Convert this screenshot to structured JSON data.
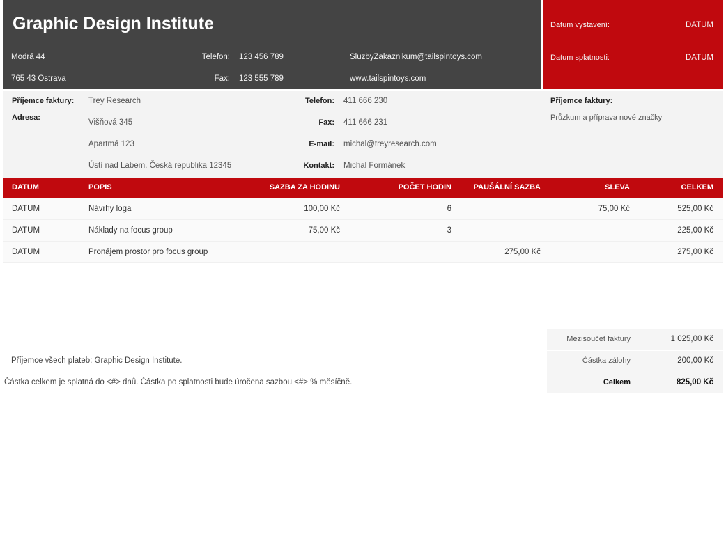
{
  "company": {
    "name": "Graphic Design Institute",
    "street": "Modrá 44",
    "city": "765 43 Ostrava",
    "phone_label": "Telefon:",
    "phone": "123 456 789",
    "fax_label": "Fax:",
    "fax": "123 555 789",
    "email": "SluzbyZakaznikum@tailspintoys.com",
    "web": "www.tailspintoys.com"
  },
  "dates": {
    "issue_label": "Datum vystavení:",
    "issue_value": "DATUM",
    "due_label": "Datum splatnosti:",
    "due_value": "DATUM"
  },
  "bill_to": {
    "recipient_label": "Příjemce faktury:",
    "recipient": "Trey Research",
    "address_label": "Adresa:",
    "address_lines": [
      "Višňová 345",
      "Apartmá 123",
      "Ústí nad Labem, Česká republika 12345"
    ],
    "phone_label": "Telefon:",
    "phone": "411 666 230",
    "fax_label": "Fax:",
    "fax": "411 666 231",
    "email_label": "E-mail:",
    "email": "michal@treyresearch.com",
    "contact_label": "Kontakt:",
    "contact": "Michal Formánek",
    "project_label": "Příjemce faktury:",
    "project": "Průzkum a příprava nové značky"
  },
  "table": {
    "headers": {
      "date": "DATUM",
      "desc": "POPIS",
      "rate": "SAZBA ZA HODINU",
      "hours": "POČET HODIN",
      "flat": "PAUŠÁLNÍ SAZBA",
      "discount": "SLEVA",
      "total": "CELKEM"
    },
    "rows": [
      {
        "date": "DATUM",
        "desc": "Návrhy loga",
        "rate": "100,00 Kč",
        "hours": "6",
        "flat": "",
        "discount": "75,00 Kč",
        "total": "525,00 Kč"
      },
      {
        "date": "DATUM",
        "desc": "Náklady na focus group",
        "rate": "75,00 Kč",
        "hours": "3",
        "flat": "",
        "discount": "",
        "total": "225,00 Kč"
      },
      {
        "date": "DATUM",
        "desc": "Pronájem prostor pro focus group",
        "rate": "",
        "hours": "",
        "flat": "275,00 Kč",
        "discount": "",
        "total": "275,00 Kč"
      }
    ]
  },
  "totals": {
    "subtotal_label": "Mezisoučet faktury",
    "subtotal": "1 025,00 Kč",
    "deposit_label": "Částka zálohy",
    "deposit": "200,00 Kč",
    "total_label": "Celkem",
    "total": "825,00 Kč"
  },
  "notes": {
    "payee": "Příjemce všech plateb: Graphic Design Institute.",
    "terms": "Částka celkem je splatná do <#> dnů. Částka po splatnosti bude úročena sazbou <#> % měsíčně."
  }
}
